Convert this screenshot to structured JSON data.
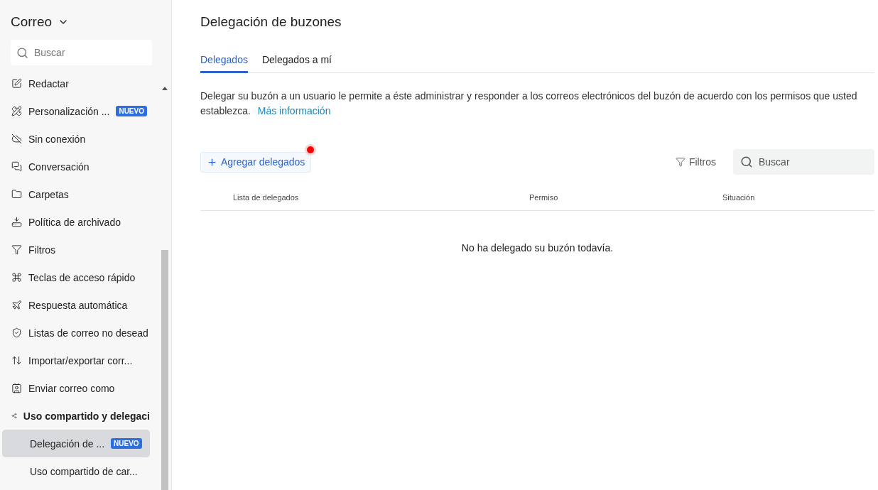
{
  "sidebar": {
    "title": "Correo",
    "search": {
      "placeholder": "Buscar"
    },
    "items": [
      {
        "kind": "compose",
        "label": "Redactar",
        "selected": false,
        "expanded": false
      },
      {
        "kind": "customize",
        "label": "Personalización ...",
        "badge": "NUEVO",
        "selected": false,
        "expanded": false
      },
      {
        "kind": "offline",
        "label": "Sin conexión",
        "selected": false,
        "expanded": false
      },
      {
        "kind": "conversation",
        "label": "Conversación",
        "selected": false,
        "expanded": false
      },
      {
        "kind": "folder",
        "label": "Carpetas",
        "selected": false,
        "expanded": false
      },
      {
        "kind": "archive",
        "label": "Política de archivado",
        "selected": false,
        "expanded": false
      },
      {
        "kind": "filter",
        "label": "Filtros",
        "selected": false,
        "expanded": false
      },
      {
        "kind": "shortcut",
        "label": "Teclas de acceso rápido",
        "selected": false,
        "expanded": false
      },
      {
        "kind": "autoreply",
        "label": "Respuesta automática",
        "selected": false,
        "expanded": false
      },
      {
        "kind": "shield",
        "label": "Listas de correo no desead",
        "selected": false,
        "expanded": false
      },
      {
        "kind": "importexport",
        "label": "Importar/exportar corr...",
        "selected": false,
        "expanded": false
      },
      {
        "kind": "sendas",
        "label": "Enviar correo como",
        "selected": false,
        "expanded": false
      },
      {
        "kind": "share",
        "label": "Uso compartido y delegaci",
        "selected": false,
        "expanded": true
      },
      {
        "kind": "subitem",
        "label": "Delegación de ...",
        "badge": "NUEVO",
        "selected": true,
        "expanded": false
      },
      {
        "kind": "subitem",
        "label": "Uso compartido de car...",
        "selected": false,
        "expanded": false
      }
    ]
  },
  "main": {
    "title": "Delegación de buzones",
    "tabs": [
      {
        "label": "Delegados",
        "selected": true
      },
      {
        "label": "Delegados a mí",
        "selected": false
      }
    ],
    "description": "Delegar su buzón a un usuario le permite a éste administrar y responder a los correos electrónicos del buzón de acuerdo con los permisos que usted establezca.",
    "link": "Más información",
    "add_button": {
      "label": "Agregar delegados",
      "notification": true
    },
    "filters": "Filtros",
    "search": {
      "placeholder": "Buscar"
    },
    "table": {
      "columns": [
        "Lista de delegados",
        "Permiso",
        "Situación"
      ],
      "empty_message": "No ha delegado su buzón todavía."
    }
  }
}
